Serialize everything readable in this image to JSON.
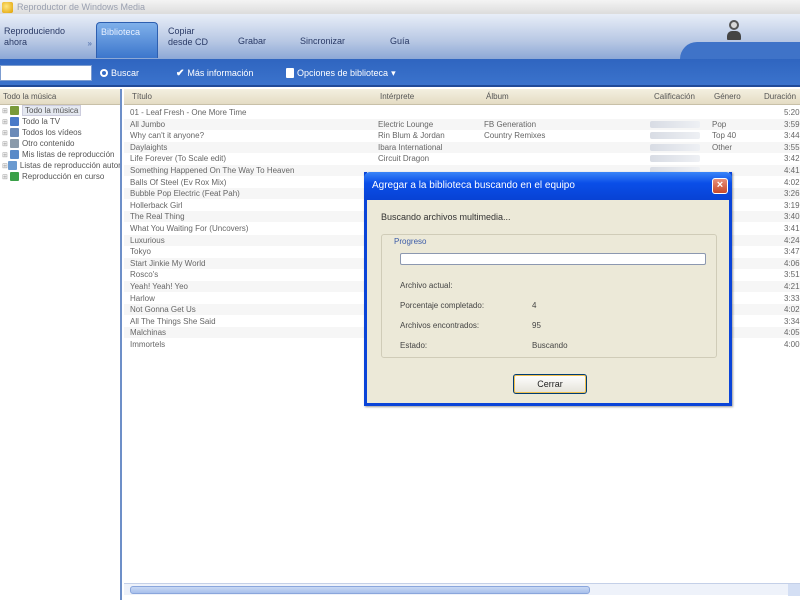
{
  "window": {
    "title": "Reproductor de Windows Media"
  },
  "tabs": [
    {
      "label": "Reproduciendo ahora",
      "active": false
    },
    {
      "label": "Biblioteca",
      "active": true
    },
    {
      "label": "Copiar desde CD",
      "active": false
    },
    {
      "label": "Grabar",
      "active": false
    },
    {
      "label": "Sincronizar",
      "active": false
    },
    {
      "label": "Guía",
      "active": false
    }
  ],
  "toolbar": {
    "search_value": "",
    "search_label": "Buscar",
    "more_info_label": "Más información",
    "library_options_label": "Opciones de biblioteca"
  },
  "left_pane": {
    "header": "Todo la música",
    "items": [
      {
        "label": "Todo la música",
        "selected": true,
        "color": "#7a9a3a"
      },
      {
        "label": "Todo la TV",
        "selected": false,
        "color": "#4a7ac8"
      },
      {
        "label": "Todos los vídeos",
        "selected": false,
        "color": "#6a8ab8"
      },
      {
        "label": "Otro contenido",
        "selected": false,
        "color": "#8a9aaa"
      },
      {
        "label": "Mis listas de reproducción",
        "selected": false,
        "color": "#5a8ac8"
      },
      {
        "label": "Listas de reproducción automática",
        "selected": false,
        "color": "#6a9ad0"
      },
      {
        "label": "Reproducción en curso",
        "selected": false,
        "color": "#3aa048"
      }
    ]
  },
  "list": {
    "columns": [
      "Título",
      "Intérprete",
      "Álbum",
      "Calificación",
      "Género",
      "Duración"
    ],
    "rows": [
      {
        "title": "01 - Leaf Fresh - One More Time",
        "artist": "",
        "album": "",
        "genre": "",
        "length": "5:20"
      },
      {
        "title": "All Jumbo",
        "artist": "Electric Lounge",
        "album": "FB Generation",
        "genre": "Pop",
        "length": "3:59"
      },
      {
        "title": "Why can't it anyone?",
        "artist": "Rin Blum & Jordan",
        "album": "Country Remixes",
        "genre": "Top 40",
        "length": "3:44"
      },
      {
        "title": "Daylaights",
        "artist": "Ibara International",
        "album": "",
        "genre": "Other",
        "length": "3:55"
      },
      {
        "title": "Life Forever (To Scale edit)",
        "artist": "Circuit Dragon",
        "album": "",
        "genre": "",
        "length": "3:42"
      },
      {
        "title": "Something Happened On The Way To Heaven",
        "artist": "",
        "album": "",
        "genre": "",
        "length": "4:41"
      },
      {
        "title": "Balls Of Steel (Ev Rox Mix)",
        "artist": "",
        "album": "",
        "genre": "",
        "length": "4:02"
      },
      {
        "title": "Bubble Pop Electric (Feat Pah)",
        "artist": "",
        "album": "",
        "genre": "",
        "length": "3:26"
      },
      {
        "title": "Hollerback Girl",
        "artist": "",
        "album": "",
        "genre": "",
        "length": "3:19"
      },
      {
        "title": "The Real Thing",
        "artist": "",
        "album": "",
        "genre": "",
        "length": "3:40"
      },
      {
        "title": "What You Waiting For (Uncovers)",
        "artist": "",
        "album": "",
        "genre": "",
        "length": "3:41"
      },
      {
        "title": "Luxurious",
        "artist": "",
        "album": "",
        "genre": "",
        "length": "4:24"
      },
      {
        "title": "Tokyo",
        "artist": "",
        "album": "",
        "genre": "",
        "length": "3:47"
      },
      {
        "title": "Start Jinkie My World",
        "artist": "",
        "album": "",
        "genre": "",
        "length": "4:06"
      },
      {
        "title": "Rosco's",
        "artist": "",
        "album": "",
        "genre": "",
        "length": "3:51"
      },
      {
        "title": "Yeah! Yeah! Yeo",
        "artist": "",
        "album": "",
        "genre": "",
        "length": "4:21"
      },
      {
        "title": "Harlow",
        "artist": "",
        "album": "",
        "genre": "",
        "length": "3:33"
      },
      {
        "title": "Not Gonna Get Us",
        "artist": "",
        "album": "",
        "genre": "",
        "length": "4:02"
      },
      {
        "title": "All The Things She Said",
        "artist": "",
        "album": "",
        "genre": "",
        "length": "3:34"
      },
      {
        "title": "Malchinas",
        "artist": "",
        "album": "",
        "genre": "",
        "length": "4:05"
      },
      {
        "title": "Immortels",
        "artist": "",
        "album": "",
        "genre": "",
        "length": "4:00"
      }
    ]
  },
  "dialog": {
    "title": "Agregar a la biblioteca buscando en el equipo",
    "status": "Buscando archivos multimedia...",
    "group_label": "Progreso",
    "progress": 0,
    "fields": [
      {
        "label": "Archivo actual:",
        "value": ""
      },
      {
        "label": "Porcentaje completado:",
        "value": "4"
      },
      {
        "label": "Archivos encontrados:",
        "value": "95"
      },
      {
        "label": "Estado:",
        "value": "Buscando"
      }
    ],
    "button_label": "Cerrar"
  }
}
